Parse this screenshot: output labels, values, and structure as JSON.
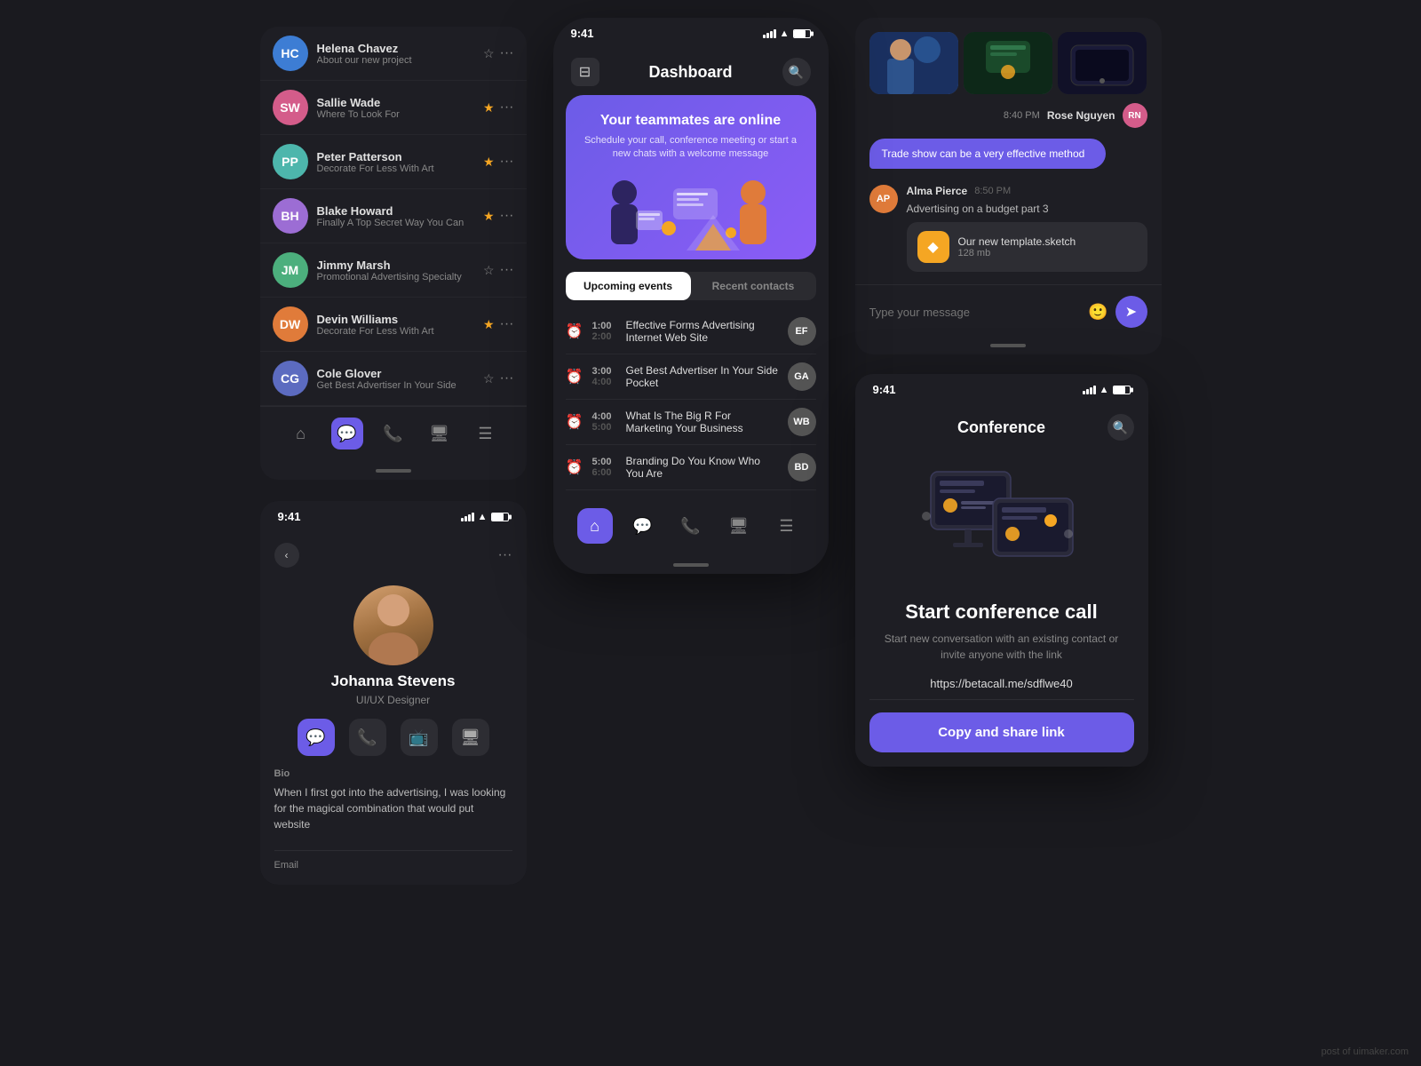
{
  "contacts": {
    "items": [
      {
        "name": "Helena Chavez",
        "msg": "About our new project",
        "starred": false,
        "avatar_color": "av-blue",
        "initials": "HC"
      },
      {
        "name": "Sallie Wade",
        "msg": "Where To Look For",
        "starred": true,
        "avatar_color": "av-pink",
        "initials": "SW"
      },
      {
        "name": "Peter Patterson",
        "msg": "Decorate For Less With Art",
        "starred": true,
        "avatar_color": "av-teal",
        "initials": "PP"
      },
      {
        "name": "Blake Howard",
        "msg": "Finally A Top Secret Way You Can",
        "starred": true,
        "avatar_color": "av-purple",
        "initials": "BH"
      },
      {
        "name": "Jimmy Marsh",
        "msg": "Promotional Advertising Specialty",
        "starred": false,
        "avatar_color": "av-green",
        "initials": "JM"
      },
      {
        "name": "Devin Williams",
        "msg": "Decorate For Less With Art",
        "starred": true,
        "avatar_color": "av-orange",
        "initials": "DW"
      },
      {
        "name": "Cole Glover",
        "msg": "Get Best Advertiser In Your Side",
        "starred": false,
        "avatar_color": "av-indigo",
        "initials": "CG"
      }
    ]
  },
  "dashboard": {
    "status_time": "9:41",
    "title": "Dashboard",
    "hero_title": "Your teammates are online",
    "hero_sub": "Schedule your call, conference meeting or start a new chats with a welcome message",
    "tabs": [
      "Upcoming events",
      "Recent contacts"
    ],
    "events": [
      {
        "start": "1:00",
        "end": "2:00",
        "title": "Effective Forms Advertising Internet Web Site",
        "initials": "EF",
        "color": "av-teal"
      },
      {
        "start": "3:00",
        "end": "4:00",
        "title": "Get Best Advertiser In Your Side Pocket",
        "initials": "GA",
        "color": "av-blue"
      },
      {
        "start": "4:00",
        "end": "5:00",
        "title": "What Is The Big R For Marketing Your Business",
        "initials": "WB",
        "color": "av-orange"
      },
      {
        "start": "5:00",
        "end": "6:00",
        "title": "Branding Do You Know Who You Are",
        "initials": "BD",
        "color": "av-purple"
      }
    ]
  },
  "chat": {
    "status_time": "9:41",
    "photos": [
      "📸",
      "📱",
      "📱"
    ],
    "time1": "8:40 PM",
    "sender1": "Rose Nguyen",
    "bubble_text": "Trade show can be a very effective method",
    "sender2_name": "Alma Pierce",
    "sender2_time": "8:50 PM",
    "sender2_text": "Advertising on a budget part 3",
    "file_name": "Our new template.sketch",
    "file_size": "128 mb",
    "input_placeholder": "Type your message"
  },
  "profile": {
    "status_time": "9:41",
    "name": "Johanna Stevens",
    "role": "UI/UX Designer",
    "bio_label": "Bio",
    "bio_text": "When I first got into the advertising, I was looking for the magical combination that would put website",
    "email_label": "Email"
  },
  "conference": {
    "status_time": "9:41",
    "title": "Conference",
    "cta_title": "Start conference call",
    "cta_sub": "Start new conversation with an existing contact or invite  anyone with the link",
    "link": "https://betacall.me/sdflwe40",
    "cta_button": "Copy and share link"
  },
  "watermark": "post of uimaker.com"
}
